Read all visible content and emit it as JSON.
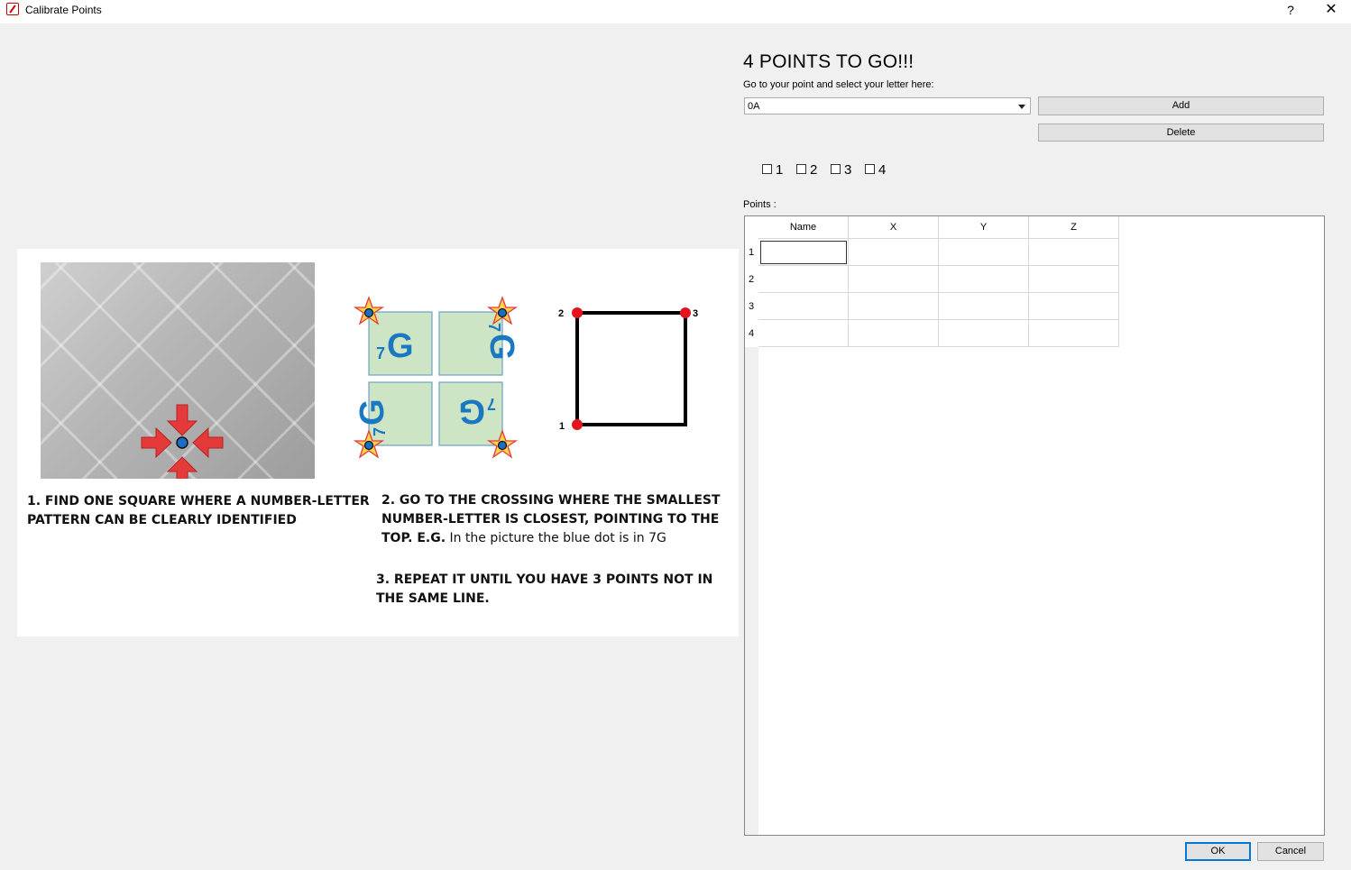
{
  "window": {
    "title": "Calibrate Points",
    "help_label": "?",
    "close_label": "✕"
  },
  "heading": "4 POINTS TO GO!!!",
  "prompt": "Go to your point and select your letter here:",
  "letter_select": {
    "value": "0A"
  },
  "buttons": {
    "add": "Add",
    "delete": "Delete",
    "ok": "OK",
    "cancel": "Cancel"
  },
  "checkboxes": [
    {
      "label": "1",
      "checked": false
    },
    {
      "label": "2",
      "checked": false
    },
    {
      "label": "3",
      "checked": false
    },
    {
      "label": "4",
      "checked": false
    }
  ],
  "points_label": "Points :",
  "table": {
    "columns": [
      "Name",
      "X",
      "Y",
      "Z"
    ],
    "rows": [
      "1",
      "2",
      "3",
      "4"
    ]
  },
  "instructions": {
    "step1": "1. FIND ONE SQUARE WHERE A NUMBER-LETTER PATTERN CAN BE CLEARLY IDENTIFIED",
    "step2_bold": "2. GO TO THE CROSSING WHERE THE SMALLEST NUMBER-LETTER IS CLOSEST, POINTING TO THE TOP. E.G.",
    "step2_normal": " In the picture the blue dot is in 7G",
    "step3": "3. REPEAT IT UNTIL YOU HAVE 3 POINTS NOT IN THE SAME LINE.",
    "tile_number": "7",
    "tile_letter": "G",
    "corner_labels": [
      "2",
      "3",
      "1"
    ]
  },
  "colors": {
    "arrow_red": "#e53a3a",
    "dot_blue": "#1a6fc4",
    "tile_green": "#cde5c4",
    "star_yellow": "#ffd24a",
    "corner_red": "#e3141b"
  }
}
